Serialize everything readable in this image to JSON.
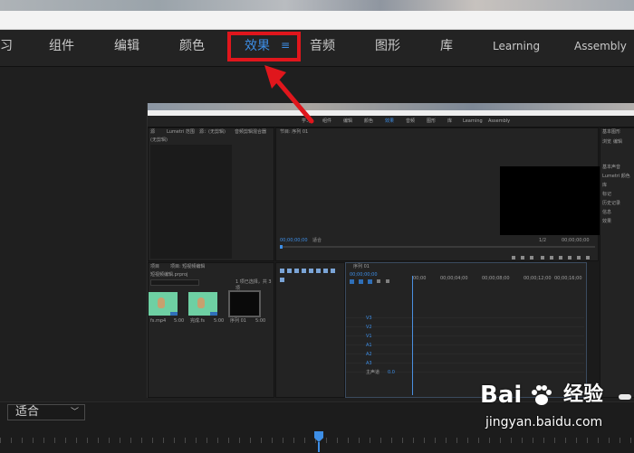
{
  "workspace_tabs": [
    {
      "label": "习",
      "active": false
    },
    {
      "label": "组件",
      "active": false
    },
    {
      "label": "编辑",
      "active": false
    },
    {
      "label": "颜色",
      "active": false
    },
    {
      "label": "效果",
      "active": true
    },
    {
      "label": "音频",
      "active": false
    },
    {
      "label": "图形",
      "active": false
    },
    {
      "label": "库",
      "active": false
    },
    {
      "label": "Learning",
      "active": false
    },
    {
      "label": "Assembly",
      "active": false
    }
  ],
  "active_menu_icon": "menu-icon",
  "accent_color": "#3d8ee6",
  "highlight_color": "#e0161c",
  "arrow_color": "#e0161c",
  "embedded": {
    "workspace_tabs": [
      "学习",
      "组件",
      "编辑",
      "颜色",
      "效果",
      "音频",
      "图形",
      "库",
      "Learning",
      "Assembly"
    ],
    "source_tabs": [
      "源",
      "Lumetri 范围",
      "源：(无剪辑)",
      "音频剪辑混合器"
    ],
    "source_sub": "(无剪辑)",
    "program_tab": "节目: 序列 01",
    "program_tc_left": "00;00;00;00",
    "program_fit": "适合",
    "program_ratio": "1/2",
    "program_tc_right": "00;00;00;00",
    "project_tabs": [
      "项目",
      "项目: 短视频编辑"
    ],
    "project_name": "短视频编辑.prproj",
    "project_count": "1 项已选择，共 3 项",
    "thumbs": [
      {
        "label": "fs.mp4",
        "sub": "5:00"
      },
      {
        "label": "完成.fs",
        "sub": "5:00"
      },
      {
        "label": "序列 01",
        "sub": "5:00"
      }
    ],
    "timeline_tab": "序列 01",
    "timeline_tc": "00;00;00;00",
    "timeline_ticks": [
      "00;00",
      "00;00;04;00",
      "00;00;08;00",
      "00;00;12;00",
      "00;00;16;00"
    ],
    "track_labels": [
      "V3",
      "V2",
      "V1",
      "A1",
      "A2",
      "A3"
    ],
    "master_label": "主声道",
    "master_value": "0.0",
    "right_panel_title": "基本图形",
    "right_panel_items": [
      "浏览",
      "编辑",
      "基本声音",
      "Lumetri 颜色",
      "库",
      "标记",
      "历史记录",
      "信息",
      "效果"
    ]
  },
  "fit_select": {
    "value": "适合"
  },
  "watermark": {
    "logo": "Bai",
    "brand": "经验",
    "url": "jingyan.baidu.com"
  }
}
